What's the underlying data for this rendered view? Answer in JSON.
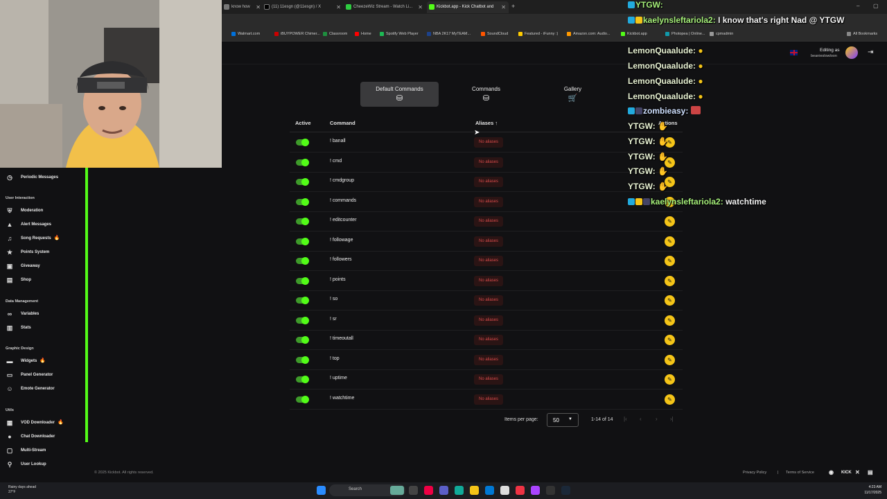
{
  "browser": {
    "tabs": [
      {
        "label": "know how",
        "color": "#777"
      },
      {
        "label": "(11) 11esgn (@11esgn) / X",
        "color": "#000"
      },
      {
        "label": "CheezeWiz Stream - Watch Li...",
        "color": "#2ecc40"
      },
      {
        "label": "Kickbot.app - Kick Chatbot and",
        "color": "#53fc18"
      }
    ],
    "bookmarks": [
      "Walmart.com",
      "iBUYPOWER Chimer...",
      "Classroom",
      "Home",
      "Spotify Web Player",
      "NBA 2K17 MyTEAM...",
      "SoundCloud",
      "Featured - iFunny :)",
      "Amazon.com: Audio...",
      "Kickbot.app",
      "Photopea | Online...",
      "cpmadmin",
      "All Bookmarks"
    ]
  },
  "header": {
    "editing_label": "Editing as",
    "editing_user": "beanieslowloon"
  },
  "tabs": [
    {
      "label": "Default Commands",
      "active": true
    },
    {
      "label": "Commands",
      "active": false
    },
    {
      "label": "Gallery",
      "active": false
    }
  ],
  "table": {
    "headers": {
      "active": "Active",
      "command": "Command",
      "aliases": "Aliases ↑",
      "actions": "Actions"
    },
    "rows": [
      {
        "command": "! banall",
        "aliases": "No aliases"
      },
      {
        "command": "! cmd",
        "aliases": "No aliases"
      },
      {
        "command": "! cmdgroup",
        "aliases": "No aliases"
      },
      {
        "command": "! commands",
        "aliases": "No aliases"
      },
      {
        "command": "! editcounter",
        "aliases": "No aliases"
      },
      {
        "command": "! followage",
        "aliases": "No aliases"
      },
      {
        "command": "! followers",
        "aliases": "No aliases"
      },
      {
        "command": "! points",
        "aliases": "No aliases"
      },
      {
        "command": "! so",
        "aliases": "No aliases"
      },
      {
        "command": "! sr",
        "aliases": "No aliases"
      },
      {
        "command": "! timeoutall",
        "aliases": "No aliases"
      },
      {
        "command": "! top",
        "aliases": "No aliases"
      },
      {
        "command": "! uptime",
        "aliases": "No aliases"
      },
      {
        "command": "! watchtime",
        "aliases": "No aliases"
      }
    ]
  },
  "pager": {
    "items_per_page_label": "Items per page:",
    "items_per_page": "50",
    "range": "1-14 of 14"
  },
  "sidebar": {
    "periodic_messages": "Periodic Messages",
    "user_interaction": "User Interaction",
    "moderation": "Moderation",
    "alert_messages": "Alert Messages",
    "song_requests": "Song Requests",
    "points_system": "Points System",
    "giveaway": "Giveaway",
    "shop": "Shop",
    "data_management": "Data Management",
    "variables": "Variables",
    "stats": "Stats",
    "graphic_design": "Graphic Design",
    "widgets": "Widgets",
    "panel_generator": "Panel Generator",
    "emote_generator": "Emote Generator",
    "utils": "Utils",
    "vod_downloader": "VOD Downloader",
    "chat_downloader": "Chat Downloader",
    "multi_stream": "Multi-Stream",
    "user_lookup": "User Lookup"
  },
  "footer": {
    "copyright": "© 2025 Kickbot. All rights reserved.",
    "privacy": "Privacy Policy",
    "separator": "|",
    "terms": "Terms of Service",
    "kick_logo": "KICK"
  },
  "chat": [
    {
      "user": "YTGW:",
      "msg": ""
    },
    {
      "user": "kaelynsleftariola2:",
      "msg": "I know that's right Nad @ YTGW"
    },
    {
      "user": "LemonQuaalude:",
      "msg": ""
    },
    {
      "user": "LemonQuaalude:",
      "msg": ""
    },
    {
      "user": "LemonQuaalude:",
      "msg": ""
    },
    {
      "user": "LemonQuaalude:",
      "msg": ""
    },
    {
      "user": "zombieasy:",
      "msg": ""
    },
    {
      "user": "YTGW:",
      "msg": ""
    },
    {
      "user": "YTGW:",
      "msg": ""
    },
    {
      "user": "YTGW:",
      "msg": ""
    },
    {
      "user": "YTGW:",
      "msg": ""
    },
    {
      "user": "YTGW:",
      "msg": ""
    },
    {
      "user": "kaelynsleftariola2:",
      "msg": "watchtime"
    }
  ],
  "taskbar": {
    "weather": "Rainy days ahead",
    "temp": "37°F",
    "search": "Search",
    "time": "4:23 AM",
    "date": "11/17/2025"
  },
  "colors": {
    "accent": "#53fc18",
    "edit": "#f5c518",
    "alias": "#d94a4a"
  }
}
